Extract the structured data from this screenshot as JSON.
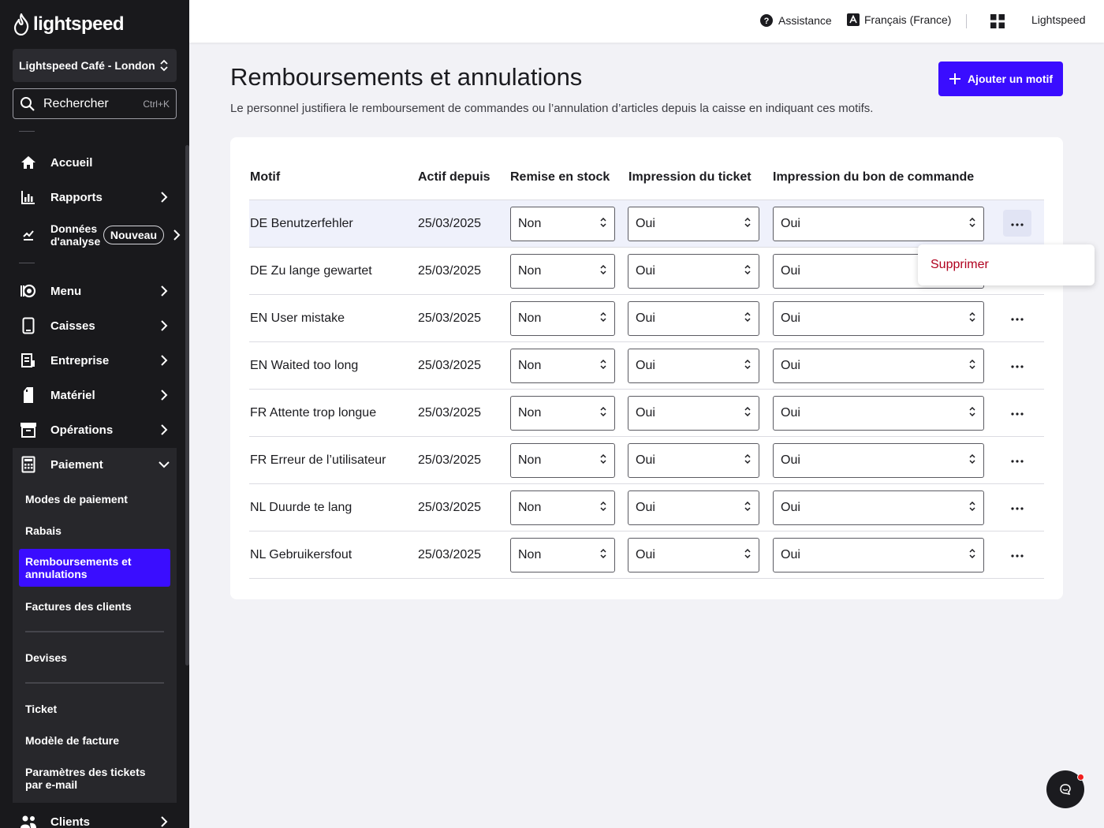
{
  "brand": {
    "name": "lightspeed",
    "accent": "#3a0dff"
  },
  "sidebar": {
    "store": "Lightspeed Café - London",
    "search": {
      "label": "Rechercher",
      "shortcut": "Ctrl+K"
    },
    "items": [
      {
        "label": "Accueil",
        "icon": "home-icon"
      },
      {
        "label": "Rapports",
        "icon": "bar-chart-icon"
      },
      {
        "label": "Données d'analyse",
        "icon": "analytics-icon",
        "badge": "Nouveau"
      },
      {
        "label": "Menu",
        "icon": "menu-book-icon"
      },
      {
        "label": "Caisses",
        "icon": "tablet-icon"
      },
      {
        "label": "Entreprise",
        "icon": "business-icon"
      },
      {
        "label": "Matériel",
        "icon": "device-icon"
      },
      {
        "label": "Opérations",
        "icon": "archive-icon"
      },
      {
        "label": "Paiement",
        "icon": "calculator-icon"
      },
      {
        "label": "Clients",
        "icon": "people-icon"
      }
    ],
    "payment_submenu": [
      {
        "label": "Modes de paiement"
      },
      {
        "label": "Rabais"
      },
      {
        "label": "Remboursements et annulations",
        "active": true
      },
      {
        "label": "Factures des clients"
      },
      {
        "label": "Devises"
      },
      {
        "label": "Ticket"
      },
      {
        "label": "Modèle de facture"
      },
      {
        "label": "Paramètres des tickets par e-mail"
      }
    ]
  },
  "topbar": {
    "help": "Assistance",
    "language": "Français (France)",
    "account": "Lightspeed"
  },
  "page": {
    "title": "Remboursements et annulations",
    "description": "Le personnel justifiera le remboursement de commandes ou l’annulation d’articles depuis la caisse en indiquant ces motifs.",
    "add_button": "Ajouter un motif"
  },
  "table": {
    "headers": [
      "Motif",
      "Actif depuis",
      "Remise en stock",
      "Impression du ticket",
      "Impression du bon de commande"
    ],
    "rows": [
      {
        "motif": "DE Benutzerfehler",
        "date": "25/03/2025",
        "stock": "Non",
        "ticket": "Oui",
        "order": "Oui"
      },
      {
        "motif": "DE Zu lange gewartet",
        "date": "25/03/2025",
        "stock": "Non",
        "ticket": "Oui",
        "order": "Oui"
      },
      {
        "motif": "EN User mistake",
        "date": "25/03/2025",
        "stock": "Non",
        "ticket": "Oui",
        "order": "Oui"
      },
      {
        "motif": "EN Waited too long",
        "date": "25/03/2025",
        "stock": "Non",
        "ticket": "Oui",
        "order": "Oui"
      },
      {
        "motif": "FR Attente trop longue",
        "date": "25/03/2025",
        "stock": "Non",
        "ticket": "Oui",
        "order": "Oui"
      },
      {
        "motif": "FR Erreur de l’utilisateur",
        "date": "25/03/2025",
        "stock": "Non",
        "ticket": "Oui",
        "order": "Oui"
      },
      {
        "motif": "NL Duurde te lang",
        "date": "25/03/2025",
        "stock": "Non",
        "ticket": "Oui",
        "order": "Oui"
      },
      {
        "motif": "NL Gebruikersfout",
        "date": "25/03/2025",
        "stock": "Non",
        "ticket": "Oui",
        "order": "Oui"
      }
    ]
  },
  "popover": {
    "delete": "Supprimer",
    "delete_color": "#b0001e"
  }
}
